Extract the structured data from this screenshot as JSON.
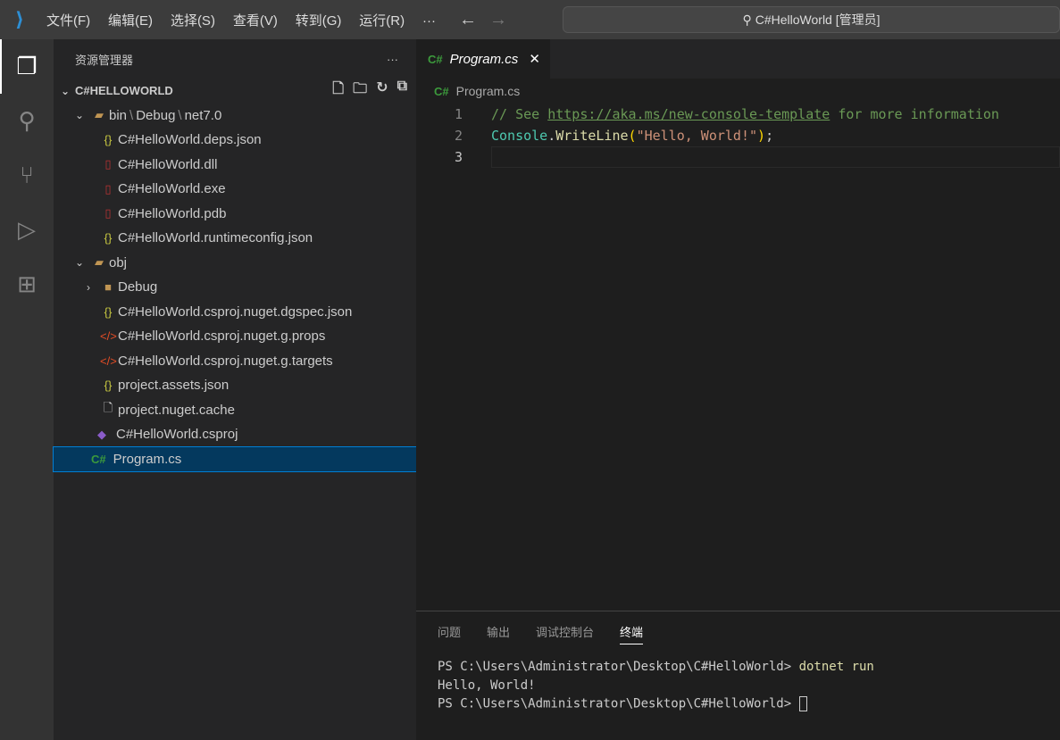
{
  "titlebar": {
    "menu": [
      "文件(F)",
      "编辑(E)",
      "选择(S)",
      "查看(V)",
      "转到(G)",
      "运行(R)"
    ],
    "more": "···",
    "search": "C#HelloWorld [管理员]"
  },
  "sidebar": {
    "title": "资源管理器",
    "more": "···",
    "root": "C#HELLOWORLD",
    "items": [
      {
        "label": "bin",
        "path2": "Debug",
        "path3": "net7.0"
      },
      {
        "label": "C#HelloWorld.deps.json"
      },
      {
        "label": "C#HelloWorld.dll"
      },
      {
        "label": "C#HelloWorld.exe"
      },
      {
        "label": "C#HelloWorld.pdb"
      },
      {
        "label": "C#HelloWorld.runtimeconfig.json"
      },
      {
        "label": "obj"
      },
      {
        "label": "Debug"
      },
      {
        "label": "C#HelloWorld.csproj.nuget.dgspec.json"
      },
      {
        "label": "C#HelloWorld.csproj.nuget.g.props"
      },
      {
        "label": "C#HelloWorld.csproj.nuget.g.targets"
      },
      {
        "label": "project.assets.json"
      },
      {
        "label": "project.nuget.cache"
      },
      {
        "label": "C#HelloWorld.csproj"
      },
      {
        "label": "Program.cs"
      }
    ]
  },
  "editor": {
    "tab": "Program.cs",
    "cs": "C#",
    "breadcrumb": "Program.cs",
    "lines": {
      "n1": "1",
      "n2": "2",
      "n3": "3",
      "c1a": "// See ",
      "c1link": "https://aka.ms/new-console-template",
      "c1b": " for more information",
      "cls": "Console",
      "dot": ".",
      "fn": "WriteLine",
      "po": "(",
      "str": "\"Hello, World!\"",
      "pc": ")",
      "semi": ";"
    }
  },
  "panel": {
    "tabs": [
      "问题",
      "输出",
      "调试控制台",
      "终端"
    ],
    "term": {
      "l1": "PS C:\\Users\\Administrator\\Desktop\\C#HelloWorld> ",
      "l1cmd": "dotnet run",
      "l2": "Hello, World!",
      "l3": "PS C:\\Users\\Administrator\\Desktop\\C#HelloWorld> "
    }
  }
}
